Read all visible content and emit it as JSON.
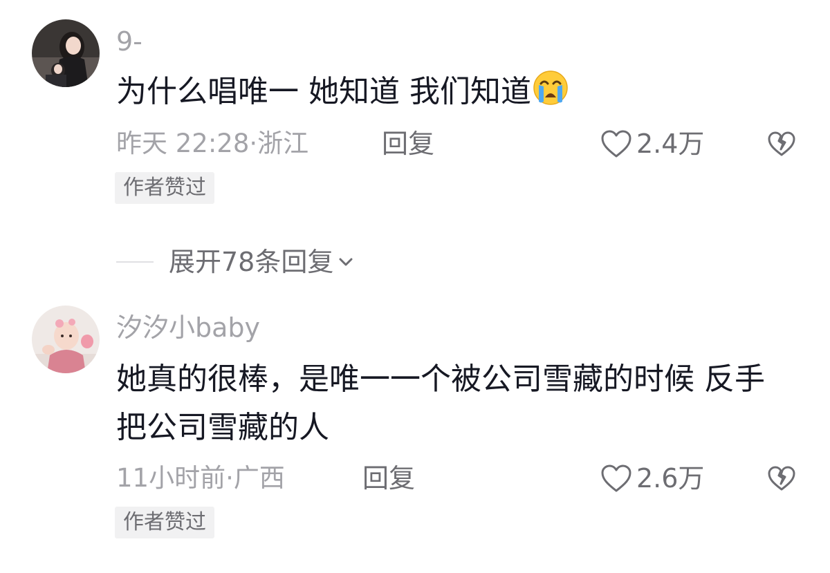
{
  "comments": [
    {
      "username": "9-",
      "text": "为什么唱唯一 她知道 我们知道",
      "emoji_icon": "loudly-crying-face-icon",
      "time_location": "昨天 22:28·浙江",
      "reply_label": "回复",
      "like_count": "2.4万",
      "badge": "作者赞过"
    },
    {
      "username": "汐汐小baby",
      "text": "她真的很棒，是唯一一个被公司雪藏的时候 反手把公司雪藏的人",
      "time_location": "11小时前·广西",
      "reply_label": "回复",
      "like_count": "2.6万",
      "badge": "作者赞过"
    }
  ],
  "expand_replies": {
    "label": "展开78条回复"
  },
  "colors": {
    "primary_text": "#161823",
    "secondary_text": "#a3a3a8",
    "action_text": "#6d6d72",
    "badge_bg": "#f1f1f2"
  }
}
